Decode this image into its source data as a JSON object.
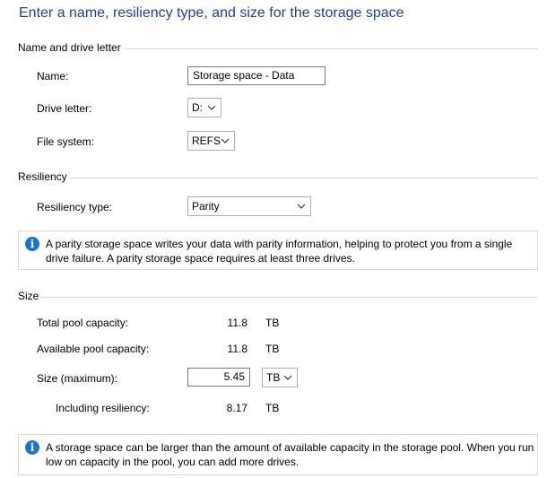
{
  "heading": "Enter a name, resiliency type, and size for the storage space",
  "name_section": {
    "title": "Name and drive letter",
    "name_label": "Name:",
    "name_value": "Storage space - Data",
    "drive_label": "Drive letter:",
    "drive_value": "D:",
    "fs_label": "File system:",
    "fs_value": "REFS"
  },
  "resiliency_section": {
    "title": "Resiliency",
    "type_label": "Resiliency type:",
    "type_value": "Parity",
    "info_text": "A parity storage space writes your data with parity information, helping to protect you from a single drive failure. A parity storage space requires at least three drives."
  },
  "size_section": {
    "title": "Size",
    "total_label": "Total pool capacity:",
    "total_value": "11.8",
    "total_unit": "TB",
    "available_label": "Available pool capacity:",
    "available_value": "11.8",
    "available_unit": "TB",
    "size_label": "Size (maximum):",
    "size_value": "5.45",
    "size_unit": "TB",
    "including_label": "Including resiliency:",
    "including_value": "8.17",
    "including_unit": "TB",
    "info_text": "A storage space can be larger than the amount of available capacity in the storage pool. When you run low on capacity in the pool, you can add more drives."
  },
  "colors": {
    "heading": "#1e3f9a",
    "info_icon": "#1d72c9",
    "section_line": "#d6d6d6"
  },
  "icons": {
    "dropdown": "chevron-down-icon",
    "info": "info-icon"
  }
}
